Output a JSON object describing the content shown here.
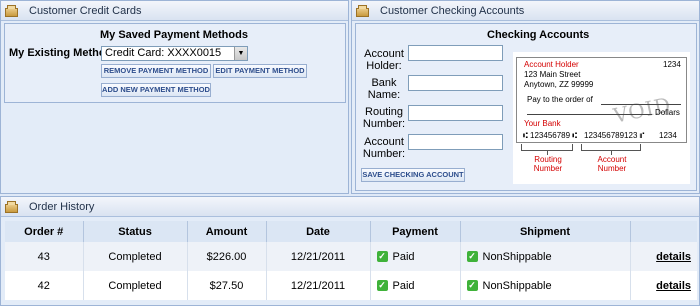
{
  "credit": {
    "header": "Customer Credit Cards",
    "section_title": "My Saved Payment Methods",
    "existing_label": "My Existing Methods:",
    "selected_method": "Credit Card: XXXX0015",
    "remove_label": "REMOVE PAYMENT METHOD",
    "edit_label": "EDIT PAYMENT METHOD",
    "add_label": "ADD NEW PAYMENT METHOD"
  },
  "checking": {
    "header": "Customer Checking Accounts",
    "section_title": "Checking Accounts",
    "fields": {
      "holder": "Account Holder:",
      "bank": "Bank Name:",
      "routing": "Routing Number:",
      "account": "Account Number:"
    },
    "save_label": "SAVE CHECKING ACCOUNT",
    "check_image": {
      "holder": "Account Holder",
      "number": "1234",
      "street": "123 Main Street",
      "city": "Anytown, ZZ 99999",
      "pay_to": "Pay to the order of",
      "dollars": "Dollars",
      "bank": "Your Bank",
      "micr_routing": "⑆ 123456789 ⑆",
      "micr_account": "123456789123 ⑈",
      "micr_check": "1234",
      "void": "VOID",
      "routing_caption": "Routing Number",
      "account_caption": "Account Number"
    }
  },
  "orders": {
    "header": "Order History",
    "columns": [
      "Order #",
      "Status",
      "Amount",
      "Date",
      "Payment",
      "Shipment",
      ""
    ],
    "rows": [
      {
        "order": "43",
        "status": "Completed",
        "amount": "$226.00",
        "date": "12/21/2011",
        "payment": "Paid",
        "shipment": "NonShippable",
        "action": "details"
      },
      {
        "order": "42",
        "status": "Completed",
        "amount": "$27.50",
        "date": "12/21/2011",
        "payment": "Paid",
        "shipment": "NonShippable",
        "action": "details"
      }
    ]
  }
}
